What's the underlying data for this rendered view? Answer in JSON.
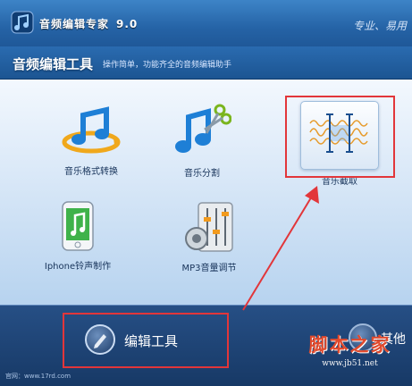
{
  "app": {
    "title": "音频编辑专家",
    "version": "9.0",
    "slogan": "专业、易用"
  },
  "header": {
    "section_title": "音频编辑工具",
    "description": "操作简单，功能齐全的音频编辑助手"
  },
  "tools": [
    {
      "label": "音乐格式转换",
      "icon": "music-convert-icon"
    },
    {
      "label": "音乐分割",
      "icon": "music-scissors-icon"
    },
    {
      "label": "音乐截取",
      "icon": "waveform-cut-icon",
      "highlighted": true
    },
    {
      "label": "Iphone铃声制作",
      "icon": "iphone-ringtone-icon"
    },
    {
      "label": "MP3音量调节",
      "icon": "volume-mixer-icon"
    }
  ],
  "bottom": {
    "edit_label": "编辑工具",
    "other_label": "其他",
    "website": "官网：www.17rd.com"
  },
  "watermark": {
    "main": "脚本之家",
    "url": "www.jb51.net"
  },
  "colors": {
    "highlight": "#e2363a",
    "accent_blue": "#2563a6",
    "watermark_red": "#e14a2d"
  }
}
